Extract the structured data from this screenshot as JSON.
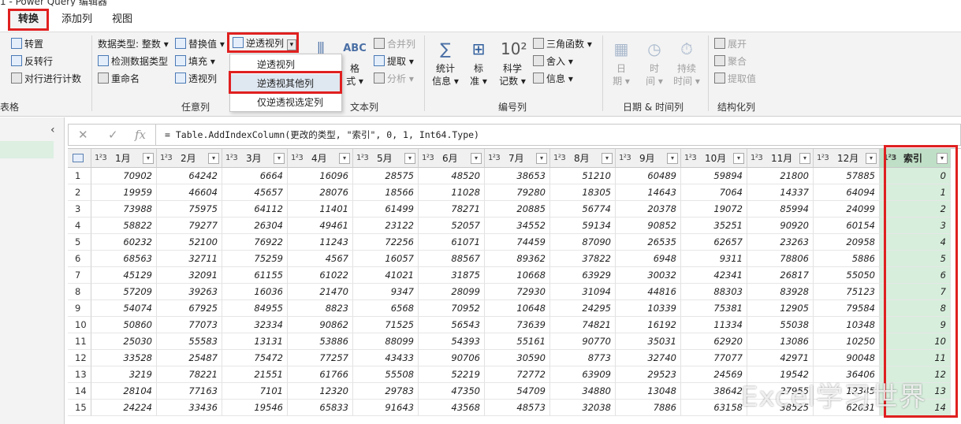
{
  "window": {
    "title": "1 - Power Query 编辑器"
  },
  "tabs": [
    "转换",
    "添加列",
    "视图"
  ],
  "ribbon": {
    "table_group": {
      "transpose": "转置",
      "reverse_rows": "反转行",
      "count_rows": "对行进行计数",
      "label": "表格"
    },
    "any_column": {
      "data_type": "数据类型: 整数",
      "detect_type": "检测数据类型",
      "rename": "重命名",
      "replace_values": "替换值",
      "fill": "填充",
      "pivot": "透视列",
      "unpivot": "逆透视列",
      "label": "任意列"
    },
    "unpivot_menu": [
      "逆透视列",
      "逆透视其他列",
      "仅逆透视选定列"
    ],
    "text_column": {
      "format_bottom": "格",
      "format_bottom2": "式",
      "merge": "合并列",
      "extract": "提取",
      "parse": "分析",
      "label": "文本列"
    },
    "number_column": {
      "statistics": "统计",
      "statistics2": "信息",
      "standard": "标",
      "standard2": "准",
      "scientific": "科学",
      "scientific2": "记数",
      "trig": "三角函数",
      "rounding": "舍入",
      "information": "信息",
      "label": "编号列"
    },
    "datetime": {
      "date": "日",
      "date2": "期",
      "time": "时",
      "time2": "间",
      "duration": "持续",
      "duration2": "时间",
      "label": "日期 & 时间列"
    },
    "structured": {
      "expand": "展开",
      "aggregate": "聚合",
      "extract_values": "提取值",
      "label": "结构化列"
    }
  },
  "formula_bar": {
    "cancel_glyph": "✕",
    "confirm_glyph": "✓",
    "fx_label": "fx",
    "formula": "= Table.AddIndexColumn(更改的类型, \"索引\", 0, 1, Int64.Type)"
  },
  "grid": {
    "type_label": "1²3",
    "columns": [
      "1月",
      "2月",
      "3月",
      "4月",
      "5月",
      "6月",
      "7月",
      "8月",
      "9月",
      "10月",
      "11月",
      "12月",
      "索引"
    ],
    "rows": [
      [
        70902,
        64242,
        6664,
        16096,
        28575,
        48520,
        38653,
        51210,
        60489,
        59894,
        21800,
        57885,
        0
      ],
      [
        19959,
        46604,
        45657,
        28076,
        18566,
        11028,
        79280,
        18305,
        14643,
        7064,
        14337,
        64094,
        1
      ],
      [
        73988,
        75975,
        64112,
        11401,
        61499,
        78271,
        20885,
        56774,
        20378,
        19072,
        85994,
        24099,
        2
      ],
      [
        58822,
        79277,
        26304,
        49461,
        23122,
        52057,
        34552,
        59134,
        90852,
        35251,
        90920,
        60154,
        3
      ],
      [
        60232,
        52100,
        76922,
        11243,
        72256,
        61071,
        74459,
        87090,
        26535,
        62657,
        23263,
        20958,
        4
      ],
      [
        68563,
        32711,
        75259,
        4567,
        16057,
        88567,
        89362,
        37822,
        6948,
        9311,
        78806,
        5886,
        5
      ],
      [
        45129,
        32091,
        61155,
        61022,
        41021,
        31875,
        10668,
        63929,
        30032,
        42341,
        26817,
        55050,
        6
      ],
      [
        57209,
        39263,
        16036,
        21470,
        9347,
        28099,
        72930,
        31094,
        44816,
        88303,
        83928,
        75123,
        7
      ],
      [
        54074,
        67925,
        84955,
        8823,
        6568,
        70952,
        10648,
        24295,
        10339,
        75381,
        12905,
        79584,
        8
      ],
      [
        50860,
        77073,
        32334,
        90862,
        71525,
        56543,
        73639,
        74821,
        16192,
        11334,
        55038,
        10348,
        9
      ],
      [
        25030,
        55583,
        13131,
        53886,
        88099,
        54393,
        55161,
        90770,
        35031,
        62920,
        13086,
        10250,
        10
      ],
      [
        33528,
        25487,
        75472,
        77257,
        43433,
        90706,
        30590,
        8773,
        32740,
        77077,
        42971,
        90048,
        11
      ],
      [
        3219,
        78221,
        21551,
        61766,
        55508,
        52219,
        72772,
        63909,
        29523,
        24569,
        19542,
        36406,
        12
      ],
      [
        28104,
        77163,
        7101,
        12320,
        29783,
        47350,
        54709,
        34880,
        13048,
        38642,
        27955,
        12345,
        13
      ],
      [
        24224,
        33436,
        19546,
        65833,
        91643,
        43568,
        48573,
        32038,
        7886,
        63158,
        38525,
        62631,
        14
      ]
    ]
  },
  "watermark": "Excel学习世界",
  "colors": {
    "highlight": "#e02020",
    "selected_column": "#d7eedc",
    "ribbon_bg": "#f3f3f3"
  }
}
